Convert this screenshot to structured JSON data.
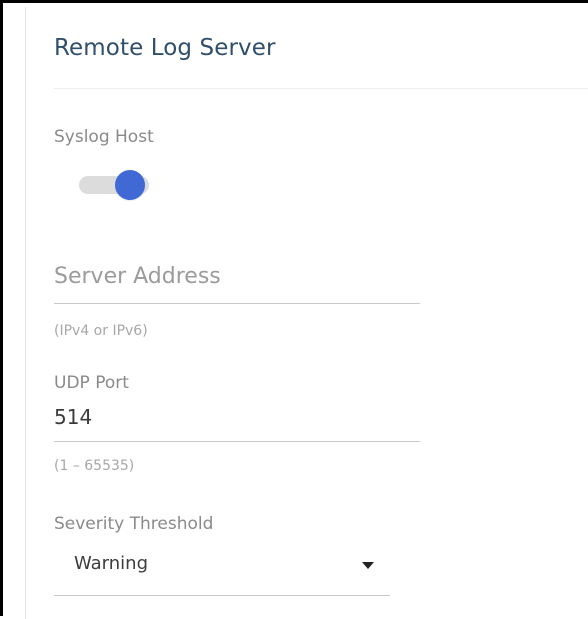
{
  "panel": {
    "title": "Remote Log Server"
  },
  "syslog": {
    "label": "Syslog Host",
    "enabled": true,
    "toggle_color": "#4169d6",
    "track_color": "#dcdcdc"
  },
  "server_address": {
    "placeholder": "Server Address",
    "hint": "(IPv4 or IPv6)"
  },
  "udp_port": {
    "label": "UDP Port",
    "value": "514",
    "hint": "(1 – 65535)"
  },
  "severity_threshold": {
    "label": "Severity Threshold",
    "selected": "Warning"
  },
  "colors": {
    "title": "#2f4f6b",
    "label": "#8a8a8a",
    "hint": "#a7a7a7",
    "divider": "#eeeeee"
  }
}
